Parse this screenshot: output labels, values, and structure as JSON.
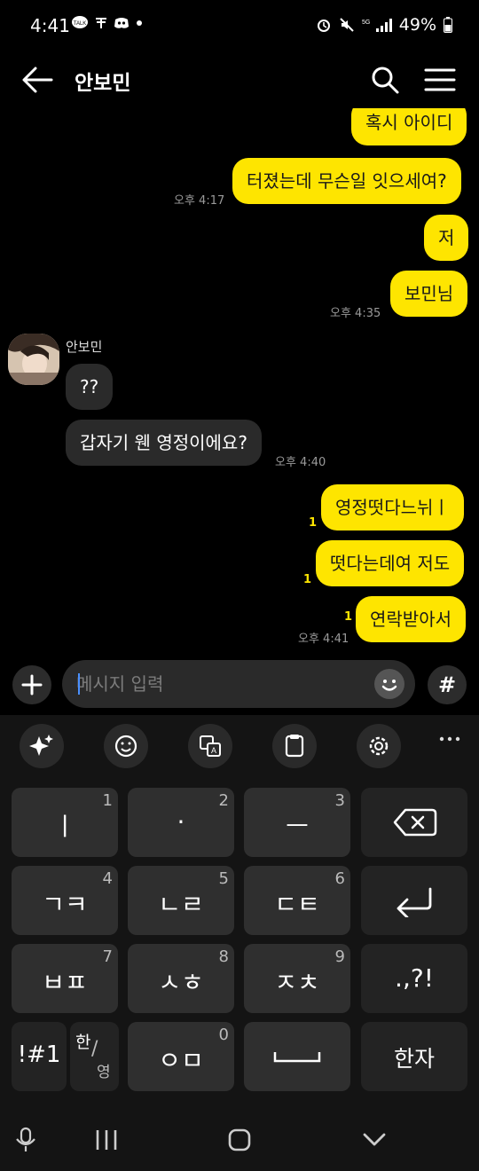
{
  "status_bar": {
    "time": "4:41",
    "left_icons": [
      "talk-icon",
      "t-icon",
      "discord-icon",
      "dot"
    ],
    "battery": "49%"
  },
  "header": {
    "title": "안보민"
  },
  "chat": {
    "messages": [
      {
        "from": "me",
        "text": "혹시 아이디"
      },
      {
        "from": "me",
        "text": "터졌는데 무슨일 잇으세여?",
        "time": "오후 4:17"
      },
      {
        "from": "me",
        "text": "저"
      },
      {
        "from": "me",
        "text": "보민님",
        "time": "오후 4:35"
      },
      {
        "from": "them",
        "text": "??"
      },
      {
        "from": "them",
        "text": "갑자기 웬 영정이에요?",
        "time": "오후 4:40"
      },
      {
        "from": "me",
        "text": "영정떳다느뉘ㅣ",
        "unread": "1"
      },
      {
        "from": "me",
        "text": "떳다는데여 저도",
        "unread": "1"
      },
      {
        "from": "me",
        "text": "연락받아서",
        "unread": "1",
        "time": "오후 4:41"
      }
    ],
    "sender": "안보민"
  },
  "input": {
    "placeholder": "메시지 입력",
    "hash": "#"
  },
  "keyboard": {
    "keys": [
      {
        "main": "ㅣ",
        "num": "1"
      },
      {
        "main": "·",
        "num": "2"
      },
      {
        "main": "ㅡ",
        "num": "3"
      },
      {
        "main": "⌫",
        "num": ""
      },
      {
        "main": "ㄱㅋ",
        "num": "4"
      },
      {
        "main": "ㄴㄹ",
        "num": "5"
      },
      {
        "main": "ㄷㅌ",
        "num": "6"
      },
      {
        "main": "↵",
        "num": ""
      },
      {
        "main": "ㅂㅍ",
        "num": "7"
      },
      {
        "main": "ㅅㅎ",
        "num": "8"
      },
      {
        "main": "ㅈㅊ",
        "num": "9"
      },
      {
        "main": ".,?!",
        "num": ""
      },
      {
        "main": "!#1",
        "num": ""
      },
      {
        "main": "한/영",
        "num": ""
      },
      {
        "main": "ㅇㅁ",
        "num": "0"
      },
      {
        "main": "␣",
        "num": ""
      },
      {
        "main": "한자",
        "num": ""
      }
    ],
    "lang_top": "한",
    "lang_bottom": "영"
  },
  "colors": {
    "my_bubble": "#FEE500",
    "their_bubble": "#2A2A2A",
    "background": "#000000"
  }
}
